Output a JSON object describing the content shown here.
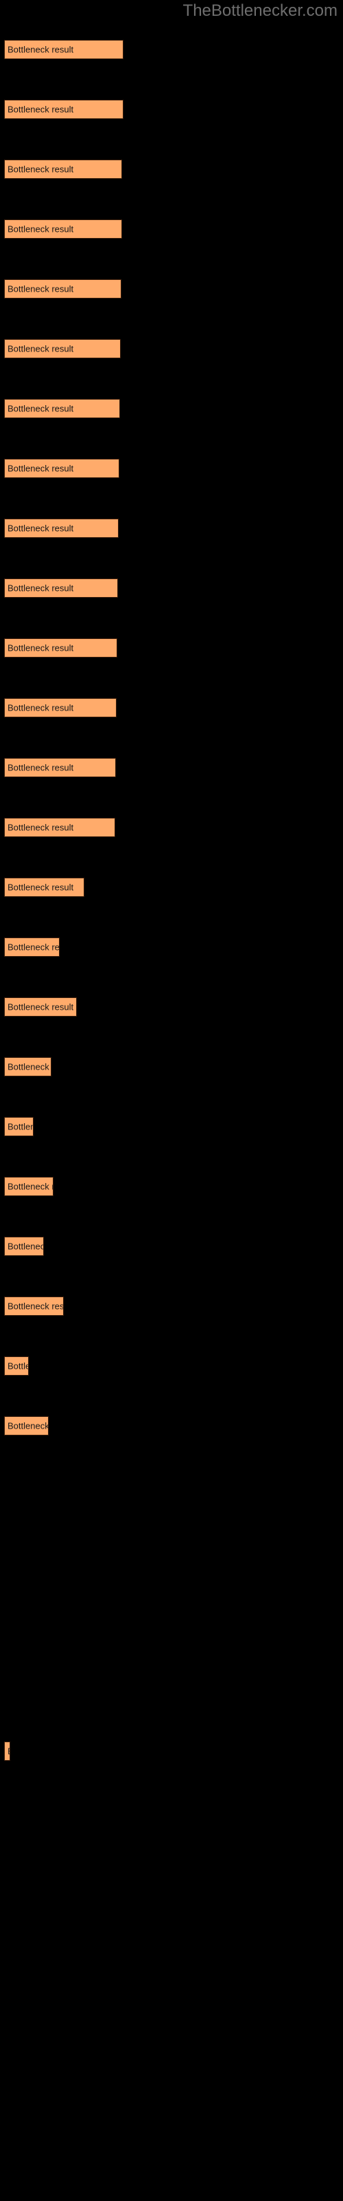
{
  "site": {
    "watermark": "TheBottlenecker.com",
    "background_color": "#000000",
    "watermark_color": "#6e6e6e"
  },
  "chart_data": {
    "type": "bar",
    "orientation": "horizontal",
    "title": "",
    "subtitle": "",
    "xlabel": "",
    "ylabel": "",
    "grid": false,
    "legend": null,
    "bar_color": "#ffab6b",
    "bar_border_color": "#3a1e0c",
    "label_color": "#1a1a1a",
    "axis_visible": false,
    "tick_labels": [],
    "categories": [
      "Bottleneck result",
      "Bottleneck result",
      "Bottleneck result",
      "Bottleneck result",
      "Bottleneck result",
      "Bottleneck result",
      "Bottleneck result",
      "Bottleneck result",
      "Bottleneck result",
      "Bottleneck result",
      "Bottleneck result",
      "Bottleneck result",
      "Bottleneck result",
      "Bottleneck result",
      "Bottleneck result",
      "Bottleneck result",
      "Bottleneck result",
      "Bottleneck result",
      "Bottleneck result",
      "Bottleneck result",
      "Bottleneck result",
      "Bottleneck result",
      "Bottleneck result",
      "Bottleneck result",
      "Bottleneck result"
    ],
    "values": [
      174,
      174,
      172,
      172,
      171,
      170,
      169,
      168,
      167,
      166,
      165,
      164,
      163,
      162,
      117,
      81,
      106,
      69,
      43,
      72,
      58,
      87,
      36,
      65,
      9
    ],
    "xlim": [
      0,
      494
    ],
    "bars": [
      {
        "label": "Bottleneck result",
        "value": 174,
        "y": 58,
        "width": 174,
        "visible_text": "Bottleneck result"
      },
      {
        "label": "Bottleneck result",
        "value": 174,
        "y": 145,
        "width": 174,
        "visible_text": "Bottleneck result"
      },
      {
        "label": "Bottleneck result",
        "value": 172,
        "y": 232,
        "width": 172,
        "visible_text": "Bottleneck result"
      },
      {
        "label": "Bottleneck result",
        "value": 172,
        "y": 319,
        "width": 172,
        "visible_text": "Bottleneck result"
      },
      {
        "label": "Bottleneck result",
        "value": 171,
        "y": 406,
        "width": 171,
        "visible_text": "Bottleneck result"
      },
      {
        "label": "Bottleneck result",
        "value": 170,
        "y": 493,
        "width": 170,
        "visible_text": "Bottleneck result"
      },
      {
        "label": "Bottleneck result",
        "value": 169,
        "y": 580,
        "width": 169,
        "visible_text": "Bottleneck result"
      },
      {
        "label": "Bottleneck result",
        "value": 168,
        "y": 667,
        "width": 168,
        "visible_text": "Bottleneck result"
      },
      {
        "label": "Bottleneck result",
        "value": 167,
        "y": 754,
        "width": 167,
        "visible_text": "Bottleneck result"
      },
      {
        "label": "Bottleneck result",
        "value": 166,
        "y": 841,
        "width": 166,
        "visible_text": "Bottleneck result"
      },
      {
        "label": "Bottleneck result",
        "value": 165,
        "y": 928,
        "width": 165,
        "visible_text": "Bottleneck result"
      },
      {
        "label": "Bottleneck result",
        "value": 164,
        "y": 1015,
        "width": 164,
        "visible_text": "Bottleneck result"
      },
      {
        "label": "Bottleneck result",
        "value": 163,
        "y": 1102,
        "width": 163,
        "visible_text": "Bottleneck result"
      },
      {
        "label": "Bottleneck result",
        "value": 162,
        "y": 1189,
        "width": 162,
        "visible_text": "Bottleneck result"
      },
      {
        "label": "Bottleneck result",
        "value": 117,
        "y": 1276,
        "width": 117,
        "visible_text": "Bottleneck res"
      },
      {
        "label": "Bottleneck result",
        "value": 81,
        "y": 1363,
        "width": 81,
        "visible_text": "Bottleneck"
      },
      {
        "label": "Bottleneck result",
        "value": 106,
        "y": 1450,
        "width": 106,
        "visible_text": "Bottleneck re"
      },
      {
        "label": "Bottleneck result",
        "value": 69,
        "y": 1537,
        "width": 69,
        "visible_text": "Bottlene"
      },
      {
        "label": "Bottleneck result",
        "value": 43,
        "y": 1624,
        "width": 43,
        "visible_text": "Bottl"
      },
      {
        "label": "Bottleneck result",
        "value": 72,
        "y": 1711,
        "width": 72,
        "visible_text": "Bottlene"
      },
      {
        "label": "Bottleneck result",
        "value": 58,
        "y": 1798,
        "width": 58,
        "visible_text": "Bottlen"
      },
      {
        "label": "Bottleneck result",
        "value": 87,
        "y": 1885,
        "width": 87,
        "visible_text": "Bottleneck"
      },
      {
        "label": "Bottleneck result",
        "value": 36,
        "y": 1972,
        "width": 36,
        "visible_text": "Bott"
      },
      {
        "label": "Bottleneck result",
        "value": 65,
        "y": 2059,
        "width": 65,
        "visible_text": "Bottlene"
      },
      {
        "label": "Bottleneck result",
        "value": 9,
        "y": 2532,
        "width": 9,
        "visible_text": "B"
      }
    ]
  }
}
